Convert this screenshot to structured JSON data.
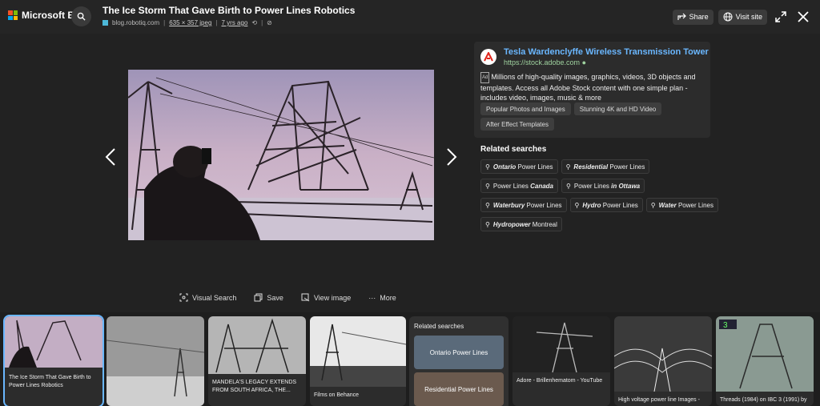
{
  "header": {
    "brand": "Microsoft Bing",
    "title": "The Ice Storm That Gave Birth to Power Lines Robotics",
    "source": "blog.robotiq.com",
    "dims": "635 × 357 jpeg",
    "age": "7 yrs ago",
    "share_label": "Share",
    "visit_label": "Visit site"
  },
  "actions": {
    "visual_search": "Visual Search",
    "save": "Save",
    "view_image": "View image",
    "more": "More"
  },
  "ad": {
    "title": "Tesla Wardenclyffe Wireless Transmission Tower",
    "url": "https://stock.adobe.com",
    "badge": "Ad",
    "text": "Millions of high-quality images, graphics, videos, 3D objects and templates. Access all Adobe Stock content with one simple plan - includes video, images, music & more",
    "chips": [
      "Popular Photos and Images",
      "Stunning 4K and HD Video",
      "After Effect Templates"
    ]
  },
  "related": {
    "title": "Related searches",
    "items": [
      {
        "bold": "Ontario",
        "rest": " Power Lines"
      },
      {
        "bold": "Residential",
        "rest": " Power Lines"
      },
      {
        "pre": "Power Lines ",
        "bold": "Canada"
      },
      {
        "pre": "Power Lines ",
        "bold": "in Ottawa"
      },
      {
        "bold": "Waterbury",
        "rest": " Power Lines"
      },
      {
        "bold": "Hydro",
        "rest": " Power Lines"
      },
      {
        "bold": "Water",
        "rest": " Power Lines"
      },
      {
        "bold": "Hydropower",
        "rest": " Montreal"
      }
    ]
  },
  "strip": {
    "captions": [
      "The Ice Storm That Gave Birth to Power Lines Robotics",
      "",
      "MANDELA'S LEGACY EXTENDS FROM SOUTH AFRICA, THE...",
      "Films on Behance",
      "",
      "Adore - Brillenhematom - YouTube",
      "High voltage power line Images -",
      "Threads (1984) on IBC 3 (1991) by"
    ],
    "related_title": "Related searches",
    "related_1": "Ontario Power Lines",
    "related_2": "Residential Power Lines",
    "logo_text": "3"
  },
  "colors": {
    "accent": "#6ab7ff",
    "bg": "#222222"
  }
}
